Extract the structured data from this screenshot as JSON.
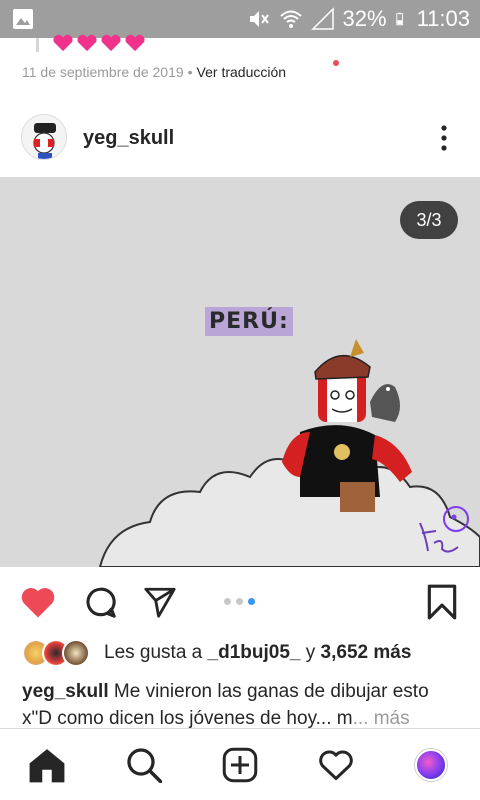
{
  "status_bar": {
    "battery": "32%",
    "time": "11:03"
  },
  "previous_post": {
    "date": "11 de septiembre de 2019",
    "separator": "•",
    "translate_label": "Ver traducción"
  },
  "post": {
    "username": "yeg_skull",
    "counter": "3/3",
    "image_label": "PERÚ:",
    "likes_prefix": "Les gusta a",
    "likes_user": "_d1buj05_",
    "likes_mid": "y",
    "likes_count": "3,652 más",
    "caption_user": "yeg_skull",
    "caption_text": "Me vinieron las ganas de dibujar esto x\"D como dicen los jóvenes de hoy... m",
    "caption_more": "... más",
    "carousel_dots": 3,
    "carousel_active": 2
  },
  "colors": {
    "heart_liked": "#ed4956",
    "dot_active": "#3897f0",
    "status_bar": "#9e9e9e"
  },
  "icons": {
    "like": "heart-filled-icon",
    "comment": "comment-icon",
    "share": "send-icon",
    "save": "bookmark-icon",
    "home": "home-icon",
    "search": "search-icon",
    "new_post": "add-post-icon",
    "activity": "heart-outline-icon"
  }
}
